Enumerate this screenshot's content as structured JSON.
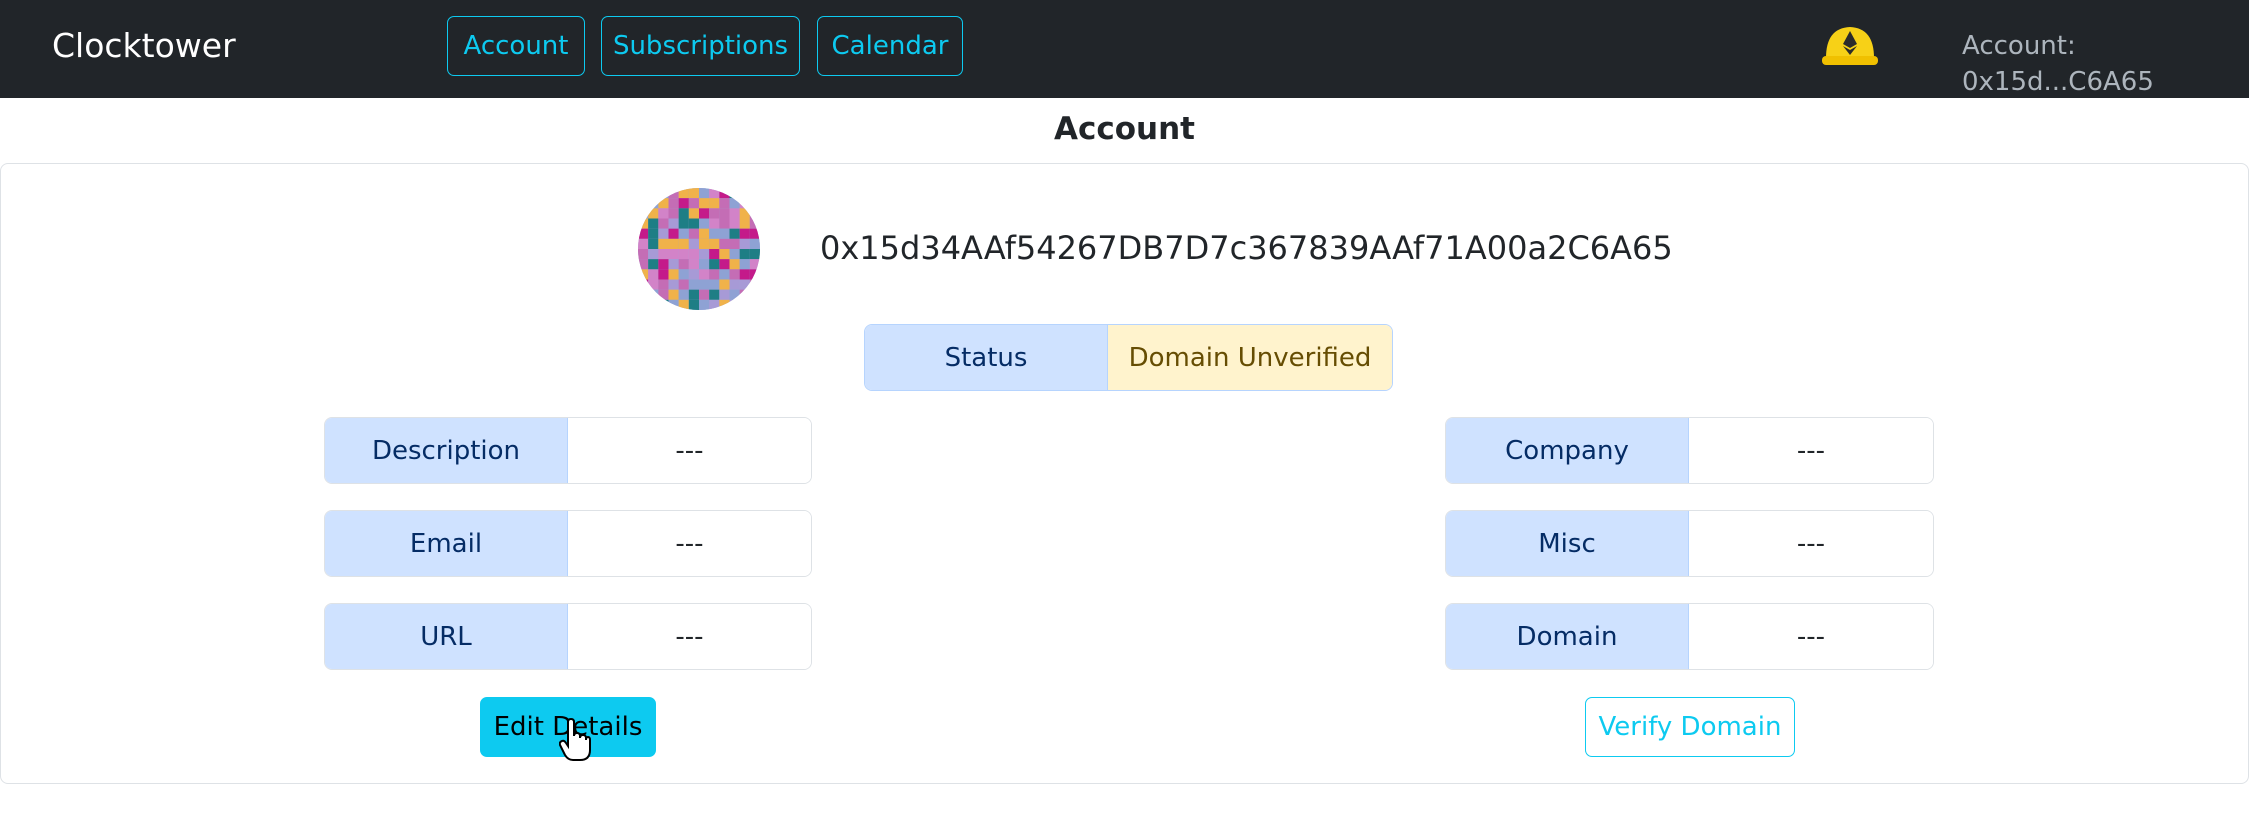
{
  "navbar": {
    "brand": "Clocktower",
    "links": [
      {
        "label": "Account"
      },
      {
        "label": "Subscriptions"
      },
      {
        "label": "Calendar"
      }
    ],
    "wallet_icon": "ethereum-helmet-icon",
    "account_label": "Account: 0x15d...C6A65"
  },
  "page": {
    "title": "Account"
  },
  "profile": {
    "avatar_icon": "identicon-avatar",
    "address": "0x15d34AAf54267DB7D7c367839AAf71A00a2C6A65",
    "status_label": "Status",
    "status_value": "Domain Unverified"
  },
  "details_left": [
    {
      "label": "Description",
      "value": "---"
    },
    {
      "label": "Email",
      "value": "---"
    },
    {
      "label": "URL",
      "value": "---"
    }
  ],
  "details_right": [
    {
      "label": "Company",
      "value": "---"
    },
    {
      "label": "Misc",
      "value": "---"
    },
    {
      "label": "Domain",
      "value": "---"
    }
  ],
  "actions": {
    "edit_label": "Edit Details",
    "verify_label": "Verify Domain"
  },
  "colors": {
    "navbar_bg": "#212529",
    "accent": "#0dcaf0",
    "label_bg": "#cfe2ff",
    "status_bg": "#fff3cd"
  }
}
